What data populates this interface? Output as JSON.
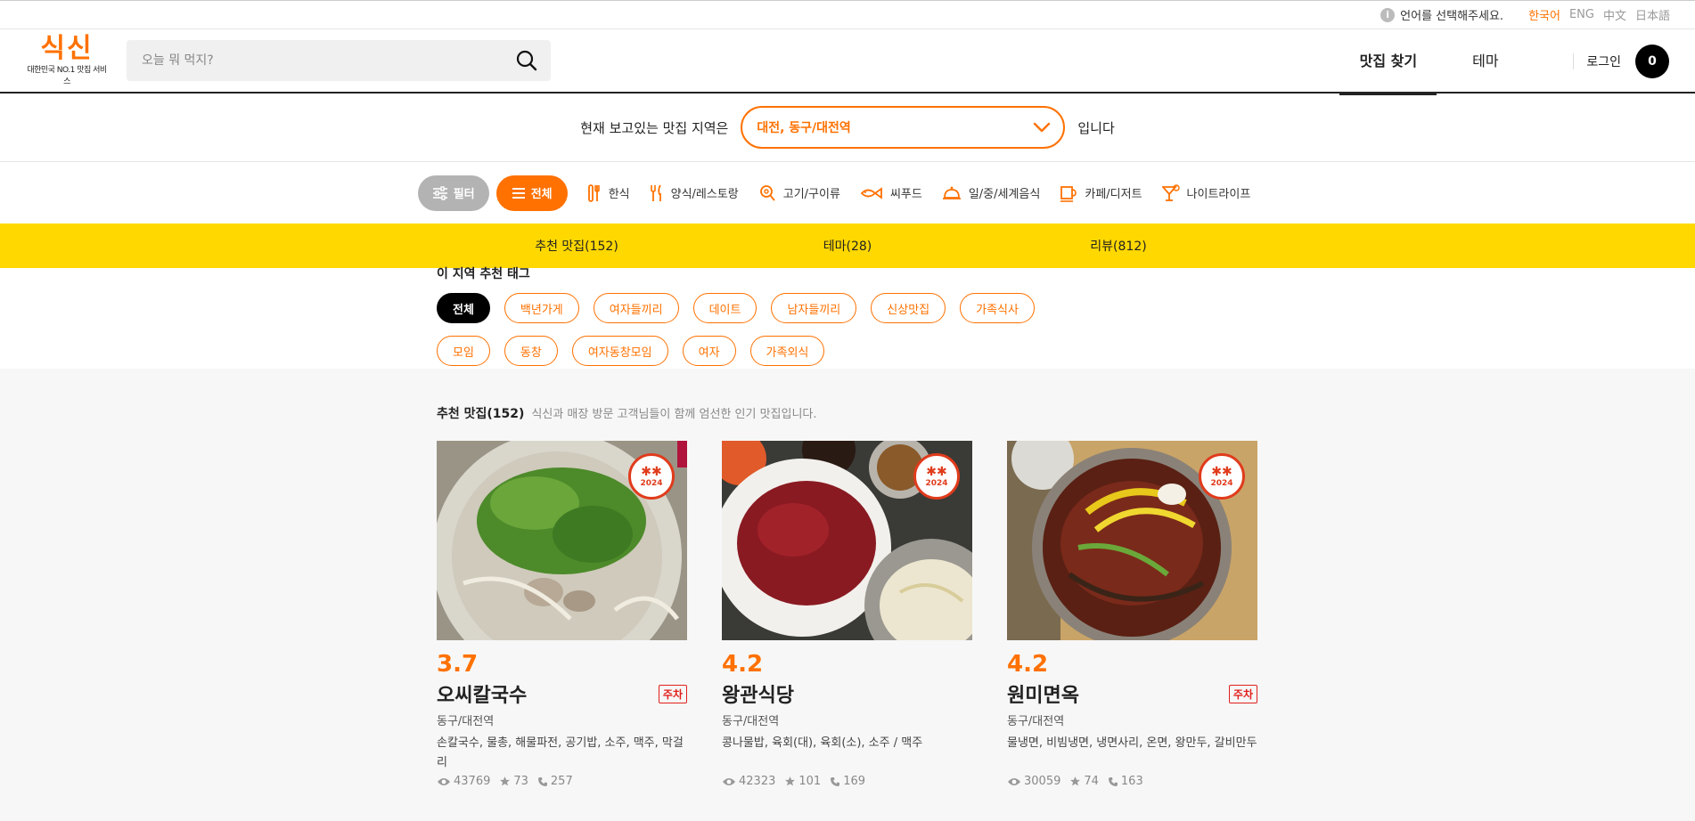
{
  "lang_bar": {
    "notice": "언어를 선택해주세요.",
    "languages": [
      "한국어",
      "ENG",
      "中文",
      "日本語"
    ]
  },
  "header": {
    "logo_text": "식신",
    "logo_sub": "대한민국 NO.1 맛집 서비스",
    "search_placeholder": "오늘 뭐 먹지?",
    "nav": [
      "맛집 찾기",
      "테마"
    ],
    "login": "로그인",
    "cart_count": "0"
  },
  "region": {
    "prefix": "현재 보고있는 맛집 지역은",
    "selected": "대전, 동구/대전역",
    "suffix": "입니다"
  },
  "categories": {
    "filter": "필터",
    "all": "전체",
    "items": [
      {
        "label": "한식",
        "icon": "utensils-icon"
      },
      {
        "label": "양식/레스토랑",
        "icon": "fork-knife-icon"
      },
      {
        "label": "고기/구이류",
        "icon": "meat-icon"
      },
      {
        "label": "씨푸드",
        "icon": "fish-icon"
      },
      {
        "label": "일/중/세계음식",
        "icon": "cloche-icon"
      },
      {
        "label": "카페/디저트",
        "icon": "coffee-icon"
      },
      {
        "label": "나이트라이프",
        "icon": "cocktail-icon"
      }
    ]
  },
  "yellow_tabs": [
    "추천 맛집(152)",
    "테마(28)",
    "리뷰(812)"
  ],
  "tags": {
    "title": "이 지역 추천 태그",
    "items": [
      "전체",
      "백년가게",
      "여자들끼리",
      "데이트",
      "남자들끼리",
      "신상맛집",
      "가족식사",
      "모임",
      "동창",
      "여자동창모임",
      "여자",
      "가족외식"
    ]
  },
  "recommend": {
    "title": "추천 맛집(152)",
    "desc": "식신과 매장 방문 고객님들이 함께 엄선한 인기 맛집입니다."
  },
  "cards": [
    {
      "rating": "3.7",
      "name": "오씨칼국수",
      "parking": "주차",
      "area": "동구/대전역",
      "menu": "손칼국수, 물총, 해물파전, 공기밥, 소주, 맥주, 막걸리",
      "views": "43769",
      "stars": "73",
      "calls": "257",
      "badge_year": "2024"
    },
    {
      "rating": "4.2",
      "name": "왕관식당",
      "parking": "",
      "area": "동구/대전역",
      "menu": "콩나물밥, 육회(대), 육회(소), 소주 / 맥주",
      "views": "42323",
      "stars": "101",
      "calls": "169",
      "badge_year": "2024"
    },
    {
      "rating": "4.2",
      "name": "원미면옥",
      "parking": "주차",
      "area": "동구/대전역",
      "menu": "물냉면, 비빔냉면, 냉면사리, 온면, 왕만두, 갈비만두",
      "views": "30059",
      "stars": "74",
      "calls": "163",
      "badge_year": "2024"
    }
  ],
  "colors": {
    "accent": "#ff7100",
    "yellow": "#ffd800",
    "badge_red": "#e03b1c"
  }
}
